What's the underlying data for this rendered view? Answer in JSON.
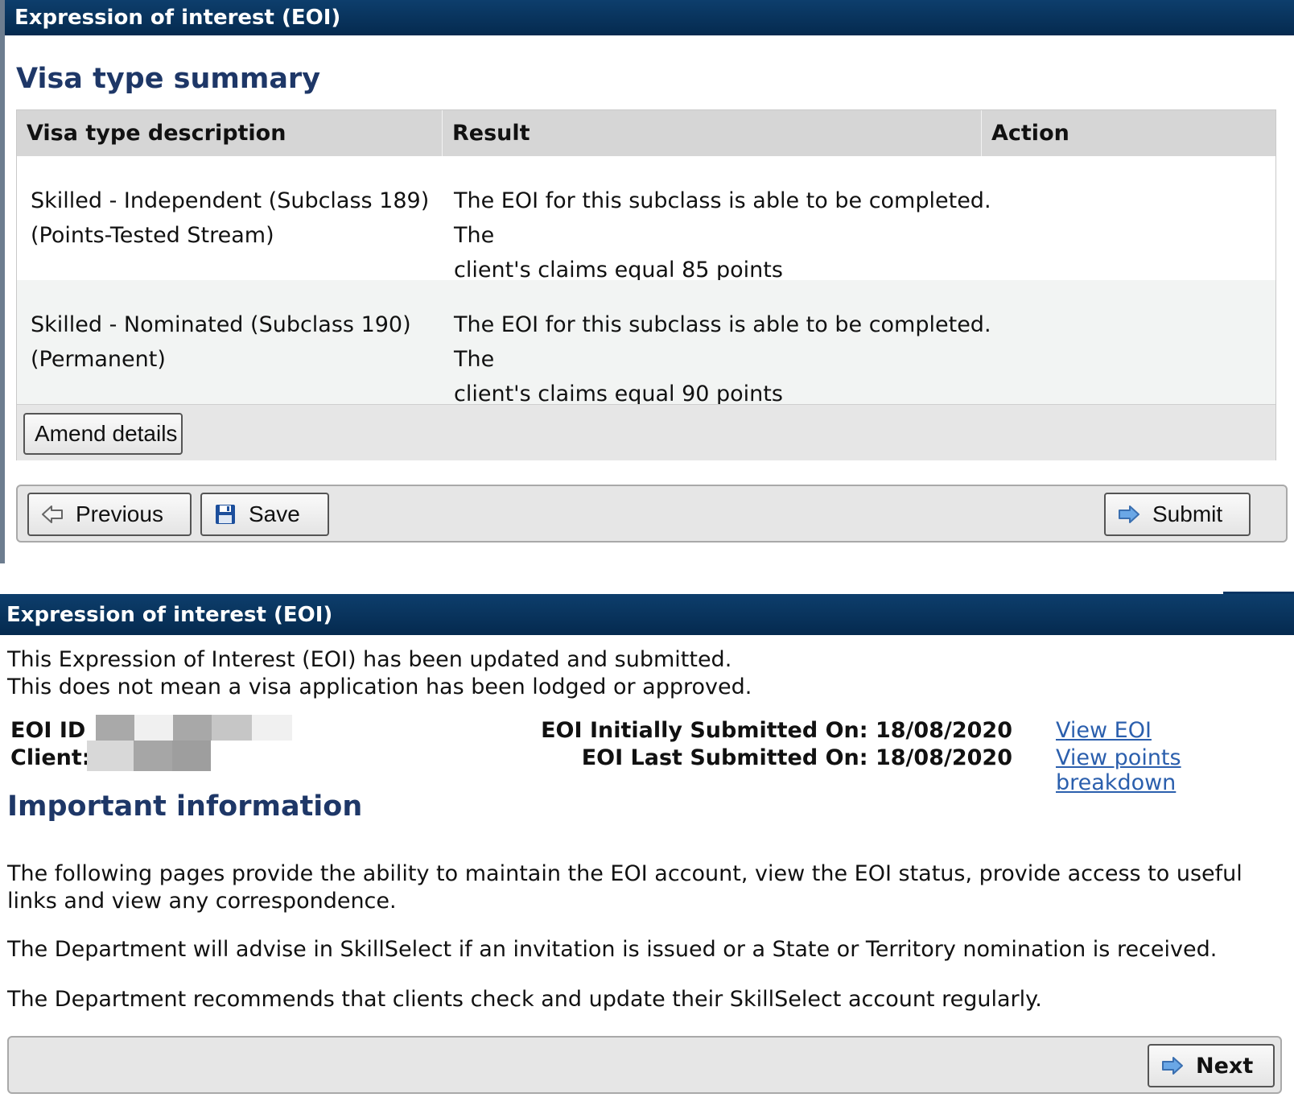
{
  "panel1": {
    "title": "Expression of interest (EOI)",
    "heading": "Visa type summary",
    "table": {
      "headers": [
        "Visa type description",
        "Result",
        "Action"
      ],
      "rows": [
        {
          "desc_line1": "Skilled - Independent (Subclass 189)",
          "desc_line2": "(Points-Tested Stream)",
          "result_line1": "The EOI for this subclass is able to be completed. The",
          "result_prefix": "client's claims ",
          "result_emph": "equal 85 points"
        },
        {
          "desc_line1": "Skilled - Nominated (Subclass 190)",
          "desc_line2": "(Permanent)",
          "result_line1": "The EOI for this subclass is able to be completed. The",
          "result_prefix": "client's claims ",
          "result_emph": "equal 90 points"
        }
      ]
    },
    "amend_label": "Amend details",
    "nav": {
      "previous": "Previous",
      "save": "Save",
      "submit": "Submit"
    }
  },
  "panel2": {
    "title": "Expression of interest (EOI)",
    "message_line1": "This Expression of Interest (EOI) has been updated and submitted.",
    "message_line2": "This does not mean a visa application has been lodged or approved.",
    "eoi_id_label": "EOI ID",
    "client_label": "Client:",
    "initially_submitted": "EOI Initially Submitted On: 18/08/2020",
    "last_submitted": "EOI Last Submitted On: 18/08/2020",
    "links": {
      "view_eoi": "View EOI",
      "view_points": "View points breakdown"
    },
    "important_heading": "Important information",
    "paragraphs": [
      "The following pages provide the ability to maintain the EOI account, view the EOI status, provide access to useful links and view any correspondence.",
      "The Department will advise in SkillSelect if an invitation is issued or a State or Territory nomination is received.",
      "The Department recommends that clients check and update their SkillSelect account regularly."
    ],
    "next_label": "Next"
  },
  "colors": {
    "title_bar": "#0a3a67",
    "heading": "#1e3767",
    "highlight_underline": "#e3141c",
    "link": "#2b5fad",
    "button_arrow": "#4a90d9"
  },
  "icons": [
    "arrow-left-icon",
    "floppy-disk-icon",
    "arrow-right-icon"
  ]
}
